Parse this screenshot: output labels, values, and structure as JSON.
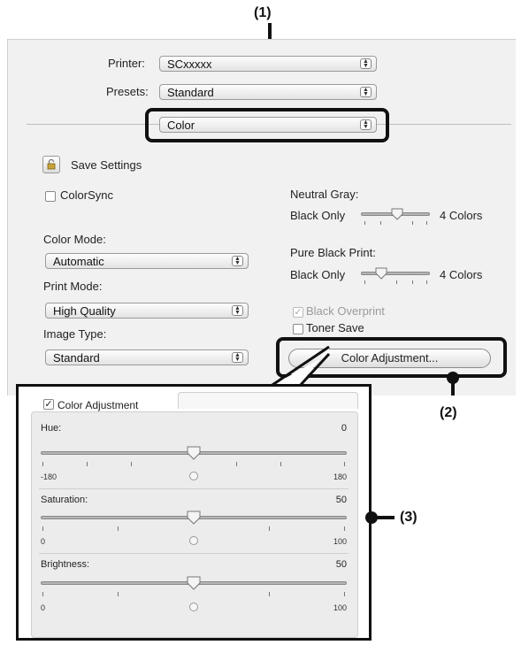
{
  "callouts": {
    "c1": "(1)",
    "c2": "(2)",
    "c3": "(3)"
  },
  "dialog": {
    "printer_label": "Printer:",
    "printer_value": "SCxxxxx",
    "presets_label": "Presets:",
    "presets_value": "Standard",
    "pane_value": "Color",
    "save_settings": "Save Settings",
    "colorsync": "ColorSync",
    "color_mode_label": "Color Mode:",
    "color_mode_value": "Automatic",
    "print_mode_label": "Print Mode:",
    "print_mode_value": "High Quality",
    "image_type_label": "Image Type:",
    "image_type_value": "Standard",
    "neutral_gray_label": "Neutral Gray:",
    "neutral_gray_left": "Black Only",
    "neutral_gray_right": "4 Colors",
    "pure_black_label": "Pure Black Print:",
    "pure_black_left": "Black Only",
    "pure_black_right": "4 Colors",
    "black_overprint": "Black Overprint",
    "toner_save": "Toner Save",
    "color_adjustment_button": "Color Adjustment..."
  },
  "zoom": {
    "checkbox_label": "Color Adjustment",
    "hue": {
      "label": "Hue:",
      "value": "0",
      "min": "-180",
      "max": "180"
    },
    "saturation": {
      "label": "Saturation:",
      "value": "50",
      "min": "0",
      "max": "100"
    },
    "brightness": {
      "label": "Brightness:",
      "value": "50",
      "min": "0",
      "max": "100"
    }
  }
}
